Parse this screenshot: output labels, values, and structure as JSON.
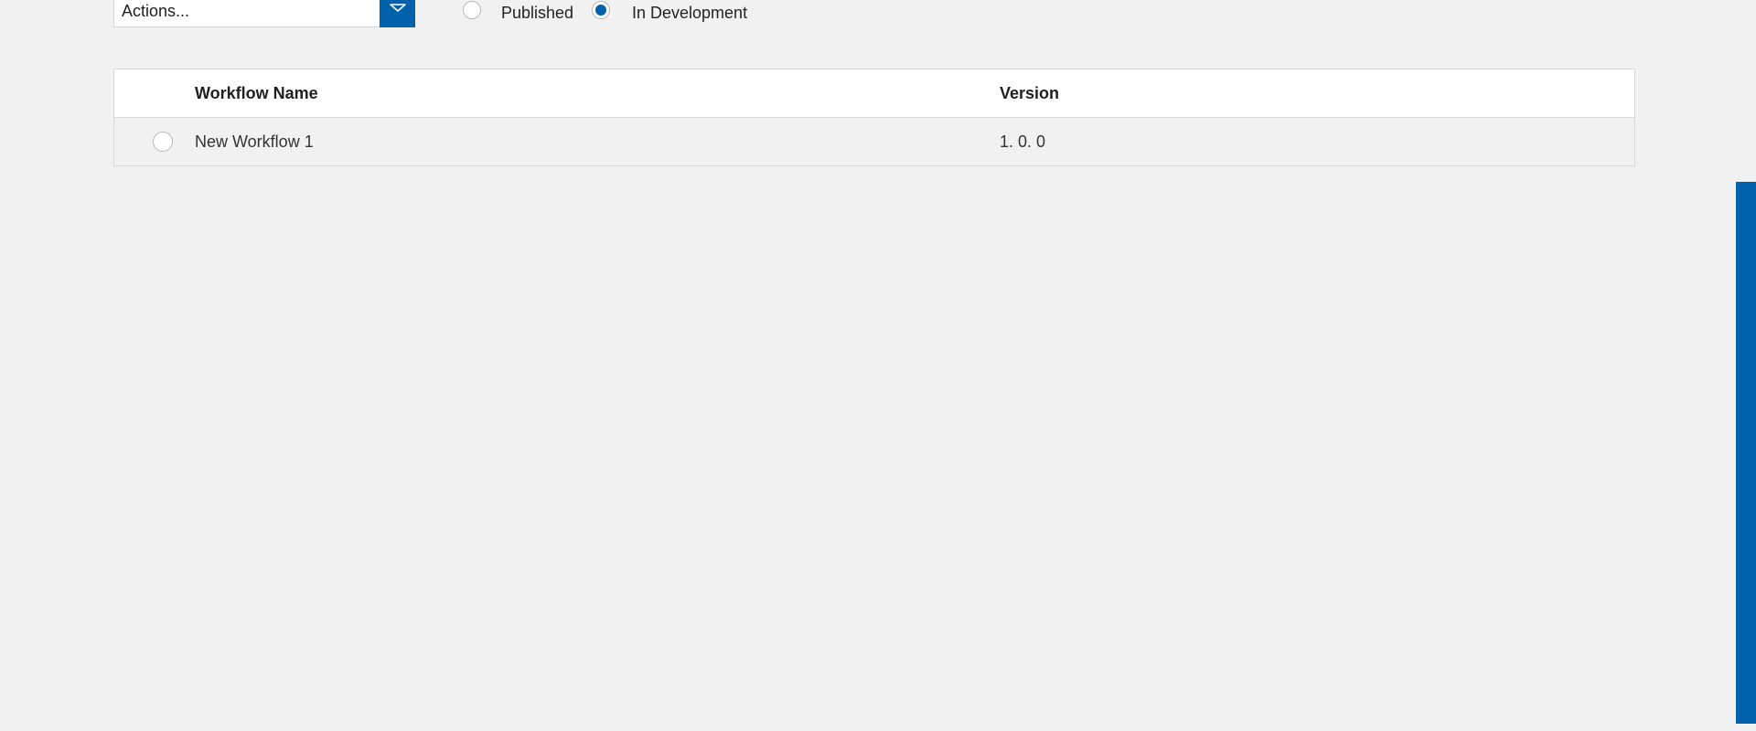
{
  "toolbar": {
    "actions_value": "Actions...",
    "filters": [
      {
        "label": "Published",
        "checked": false
      },
      {
        "label": "In Development",
        "checked": true
      }
    ]
  },
  "table": {
    "columns": [
      "Workflow Name",
      "Version"
    ],
    "rows": [
      {
        "name": "New Workflow 1",
        "version": "1. 0. 0"
      }
    ]
  },
  "icons": {
    "dropdown": "chevron-down-icon",
    "radio": "radio-icon"
  },
  "colors": {
    "accent": "#0061ac",
    "background": "#f1f1f1",
    "header_bg": "#ffffff",
    "border": "#d8d8d8"
  }
}
